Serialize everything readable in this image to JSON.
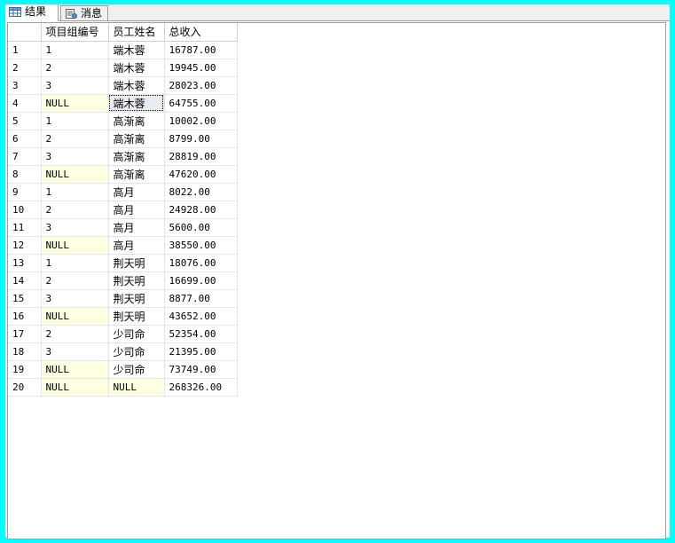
{
  "tabs": [
    {
      "label": "结果",
      "icon": "grid-icon",
      "active": true
    },
    {
      "label": "消息",
      "icon": "message-icon",
      "active": false
    }
  ],
  "columns": [
    "",
    "项目组编号",
    "员工姓名",
    "总收入"
  ],
  "rows": [
    {
      "n": "1",
      "g": "1",
      "name": "端木蓉",
      "total": "16787.00"
    },
    {
      "n": "2",
      "g": "2",
      "name": "端木蓉",
      "total": "19945.00"
    },
    {
      "n": "3",
      "g": "3",
      "name": "端木蓉",
      "total": "28023.00"
    },
    {
      "n": "4",
      "g": "NULL",
      "name": "端木蓉",
      "total": "64755.00"
    },
    {
      "n": "5",
      "g": "1",
      "name": "高渐离",
      "total": "10002.00"
    },
    {
      "n": "6",
      "g": "2",
      "name": "高渐离",
      "total": "8799.00"
    },
    {
      "n": "7",
      "g": "3",
      "name": "高渐离",
      "total": "28819.00"
    },
    {
      "n": "8",
      "g": "NULL",
      "name": "高渐离",
      "total": "47620.00"
    },
    {
      "n": "9",
      "g": "1",
      "name": "高月",
      "total": "8022.00"
    },
    {
      "n": "10",
      "g": "2",
      "name": "高月",
      "total": "24928.00"
    },
    {
      "n": "11",
      "g": "3",
      "name": "高月",
      "total": "5600.00"
    },
    {
      "n": "12",
      "g": "NULL",
      "name": "高月",
      "total": "38550.00"
    },
    {
      "n": "13",
      "g": "1",
      "name": "荆天明",
      "total": "18076.00"
    },
    {
      "n": "14",
      "g": "2",
      "name": "荆天明",
      "total": "16699.00"
    },
    {
      "n": "15",
      "g": "3",
      "name": "荆天明",
      "total": "8877.00"
    },
    {
      "n": "16",
      "g": "NULL",
      "name": "荆天明",
      "total": "43652.00"
    },
    {
      "n": "17",
      "g": "2",
      "name": "少司命",
      "total": "52354.00"
    },
    {
      "n": "18",
      "g": "3",
      "name": "少司命",
      "total": "21395.00"
    },
    {
      "n": "19",
      "g": "NULL",
      "name": "少司命",
      "total": "73749.00"
    },
    {
      "n": "20",
      "g": "NULL",
      "name": "NULL",
      "total": "268326.00"
    }
  ],
  "colors": {
    "frame": "#00ffff",
    "null_bg": "#ffffe1",
    "selected_bg": "#e8ecf0"
  }
}
